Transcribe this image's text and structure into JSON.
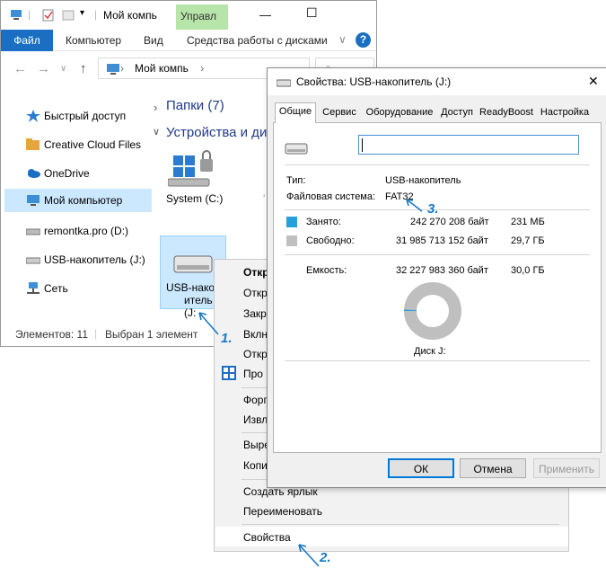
{
  "explorer": {
    "title": "Мой компь",
    "contextual_tab": "Управл",
    "ribbon_tabs": [
      "Файл",
      "Компьютер",
      "Вид",
      "Средства работы с дисками"
    ],
    "address": "Мой компь",
    "sidebar": [
      {
        "label": "Быстрый доступ",
        "icon": "star-icon"
      },
      {
        "label": "Creative Cloud Files",
        "icon": "creative-cloud-icon"
      },
      {
        "label": "OneDrive",
        "icon": "cloud-icon"
      },
      {
        "label": "Мой компьютер",
        "icon": "computer-icon",
        "selected": true
      },
      {
        "label": "remontka.pro (D:)",
        "icon": "drive-icon"
      },
      {
        "label": "USB-накопитель (J:)",
        "icon": "usb-drive-icon"
      },
      {
        "label": "Сеть",
        "icon": "network-icon"
      }
    ],
    "group_folders": "Папки (7)",
    "group_devices": "Устройства и ди",
    "drive_c": "System (C:)",
    "usb_tile_line1": "USB-накоп",
    "usb_tile_line2": "итель (J:",
    "status_items": "Элементов: 11",
    "status_selected": "Выбран 1 элемент"
  },
  "context_menu": {
    "items": [
      {
        "label": "Откр",
        "bold": true
      },
      {
        "label": "Откр"
      },
      {
        "label": "Закр"
      },
      {
        "label": "Вклн"
      },
      {
        "label": "Откр"
      },
      {
        "label": "Про"
      },
      {
        "label": "Форг"
      },
      {
        "label": "Извл"
      },
      {
        "label": "Выре"
      },
      {
        "label": "Копи"
      },
      {
        "label": "Создать ярлык"
      },
      {
        "label": "Переименовать"
      },
      {
        "label": "Свойства"
      }
    ]
  },
  "dialog": {
    "title": "Свойства: USB-накопитель (J:)",
    "tabs": [
      "Общие",
      "Сервис",
      "Оборудование",
      "Доступ",
      "ReadyBoost",
      "Настройка"
    ],
    "active_tab": "Общие",
    "name_value": "",
    "type_label": "Тип:",
    "type_value": "USB-накопитель",
    "fs_label": "Файловая система:",
    "fs_value": "FAT32",
    "used_label": "Занято:",
    "used_bytes": "242 270 208 байт",
    "used_size": "231 МБ",
    "free_label": "Свободно:",
    "free_bytes": "31 985 713 152 байт",
    "free_size": "29,7 ГБ",
    "capacity_label": "Емкость:",
    "capacity_bytes": "32 227 983 360 байт",
    "capacity_size": "30,0 ГБ",
    "disk_label": "Диск J:",
    "used_fraction": 0.0075,
    "used_color": "#26a0da",
    "free_color": "#bfbfbf",
    "buttons": {
      "ok": "ОК",
      "cancel": "Отмена",
      "apply": "Применить"
    }
  },
  "annotations": {
    "step1": "1.",
    "step2": "2.",
    "step3": "3."
  },
  "colors": {
    "accent": "#1a6fc2",
    "selection": "#cce8ff",
    "context_tab": "#b7e5a9",
    "annotation": "#1a78c2"
  }
}
